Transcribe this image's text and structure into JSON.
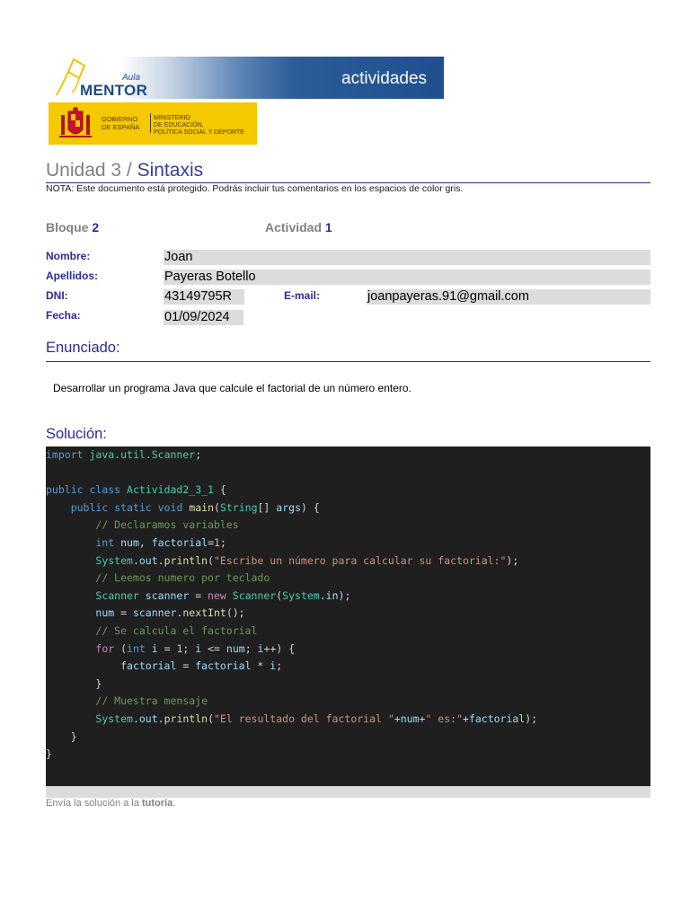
{
  "header": {
    "logo_aula": "Aula",
    "logo_mentor": "MENTOR",
    "section_title": "actividades",
    "gob_line1": "Gobierno",
    "gob_line2": "de España",
    "ministry_line1": "Ministerio",
    "ministry_line2": "de Educación,",
    "ministry_line3": "Política Social y Deporte"
  },
  "title": {
    "unit": "Unidad 3 / ",
    "name": "Sintaxis"
  },
  "note": "NOTA: Este documento está protegido. Podrás incluir tus comentarios en los espacios de color gris.",
  "bloque": {
    "label": "Bloque",
    "number": "2"
  },
  "actividad": {
    "label": "Actividad",
    "number": "1"
  },
  "form": {
    "nombre_label": "Nombre:",
    "nombre_value": "Joan",
    "apellidos_label": "Apellidos:",
    "apellidos_value": "Payeras Botello",
    "dni_label": "DNI:",
    "dni_value": "43149795R",
    "email_label": "E-mail:",
    "email_value": "joanpayeras.91@gmail.com",
    "fecha_label": "Fecha:",
    "fecha_value": "01/09/2024"
  },
  "enunciado": {
    "heading": "Enunciado:",
    "text": "Desarrollar un programa Java que calcule el factorial de un número entero."
  },
  "solucion": {
    "heading": "Solución:",
    "code_lines": [
      [
        [
          "kw",
          "import"
        ],
        [
          "plain",
          " "
        ],
        [
          "type",
          "java.util.Scanner"
        ],
        [
          "plain",
          ";"
        ]
      ],
      [],
      [
        [
          "kw",
          "public"
        ],
        [
          "plain",
          " "
        ],
        [
          "kw",
          "class"
        ],
        [
          "plain",
          " "
        ],
        [
          "type",
          "Actividad2_3_1"
        ],
        [
          "plain",
          " {"
        ]
      ],
      [
        [
          "plain",
          "    "
        ],
        [
          "kw",
          "public"
        ],
        [
          "plain",
          " "
        ],
        [
          "kw",
          "static"
        ],
        [
          "plain",
          " "
        ],
        [
          "kw",
          "void"
        ],
        [
          "plain",
          " "
        ],
        [
          "fn",
          "main"
        ],
        [
          "plain",
          "("
        ],
        [
          "type",
          "String"
        ],
        [
          "plain",
          "[] "
        ],
        [
          "var",
          "args"
        ],
        [
          "plain",
          ") {"
        ]
      ],
      [
        [
          "plain",
          "        "
        ],
        [
          "com",
          "// Declaramos variables"
        ]
      ],
      [
        [
          "plain",
          "        "
        ],
        [
          "kw",
          "int"
        ],
        [
          "plain",
          " "
        ],
        [
          "var",
          "num"
        ],
        [
          "plain",
          ", "
        ],
        [
          "var",
          "factorial"
        ],
        [
          "plain",
          "="
        ],
        [
          "num",
          "1"
        ],
        [
          "plain",
          ";"
        ]
      ],
      [
        [
          "plain",
          "        "
        ],
        [
          "type",
          "System"
        ],
        [
          "plain",
          "."
        ],
        [
          "var",
          "out"
        ],
        [
          "plain",
          "."
        ],
        [
          "fn",
          "println"
        ],
        [
          "plain",
          "("
        ],
        [
          "str",
          "\"Escribe un número para calcular su factorial:\""
        ],
        [
          "plain",
          ");"
        ]
      ],
      [
        [
          "plain",
          "        "
        ],
        [
          "com",
          "// Leemos numero por teclado"
        ]
      ],
      [
        [
          "plain",
          "        "
        ],
        [
          "type",
          "Scanner"
        ],
        [
          "plain",
          " "
        ],
        [
          "var",
          "scanner"
        ],
        [
          "plain",
          " = "
        ],
        [
          "ctl",
          "new"
        ],
        [
          "plain",
          " "
        ],
        [
          "type",
          "Scanner"
        ],
        [
          "plain",
          "("
        ],
        [
          "type",
          "System"
        ],
        [
          "plain",
          "."
        ],
        [
          "var",
          "in"
        ],
        [
          "plain",
          ");"
        ]
      ],
      [
        [
          "plain",
          "        "
        ],
        [
          "var",
          "num"
        ],
        [
          "plain",
          " = "
        ],
        [
          "var",
          "scanner"
        ],
        [
          "plain",
          "."
        ],
        [
          "fn",
          "nextInt"
        ],
        [
          "plain",
          "();"
        ]
      ],
      [
        [
          "plain",
          "        "
        ],
        [
          "com",
          "// Se calcula el factorial"
        ]
      ],
      [
        [
          "plain",
          "        "
        ],
        [
          "ctl",
          "for"
        ],
        [
          "plain",
          " ("
        ],
        [
          "kw",
          "int"
        ],
        [
          "plain",
          " "
        ],
        [
          "var",
          "i"
        ],
        [
          "plain",
          " = "
        ],
        [
          "num",
          "1"
        ],
        [
          "plain",
          "; "
        ],
        [
          "var",
          "i"
        ],
        [
          "plain",
          " <= "
        ],
        [
          "var",
          "num"
        ],
        [
          "plain",
          "; "
        ],
        [
          "var",
          "i"
        ],
        [
          "plain",
          "++) {"
        ]
      ],
      [
        [
          "plain",
          "            "
        ],
        [
          "var",
          "factorial"
        ],
        [
          "plain",
          " = "
        ],
        [
          "var",
          "factorial"
        ],
        [
          "plain",
          " * "
        ],
        [
          "var",
          "i"
        ],
        [
          "plain",
          ";"
        ]
      ],
      [
        [
          "plain",
          "        }"
        ]
      ],
      [
        [
          "plain",
          "        "
        ],
        [
          "com",
          "// Muestra mensaje"
        ]
      ],
      [
        [
          "plain",
          "        "
        ],
        [
          "type",
          "System"
        ],
        [
          "plain",
          "."
        ],
        [
          "var",
          "out"
        ],
        [
          "plain",
          "."
        ],
        [
          "fn",
          "println"
        ],
        [
          "plain",
          "("
        ],
        [
          "str",
          "\"El resultado del factorial \""
        ],
        [
          "plain",
          "+"
        ],
        [
          "var",
          "num"
        ],
        [
          "plain",
          "+"
        ],
        [
          "str",
          "\" es:\""
        ],
        [
          "plain",
          "+"
        ],
        [
          "var",
          "factorial"
        ],
        [
          "plain",
          ");"
        ]
      ],
      [
        [
          "plain",
          "    }"
        ]
      ],
      [
        [
          "plain",
          "}"
        ]
      ]
    ]
  },
  "footer": {
    "text": "Envía la solución a la ",
    "link": "tutoría",
    "end": "."
  }
}
